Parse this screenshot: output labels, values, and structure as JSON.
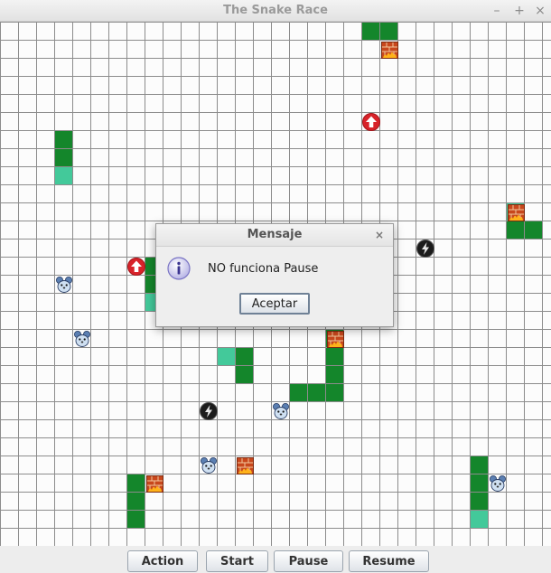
{
  "window": {
    "title": "The Snake Race",
    "minimize_glyph": "–",
    "maximize_glyph": "+",
    "close_glyph": "×"
  },
  "board": {
    "cols": 31,
    "rows": 29,
    "snake_color": "#14862b",
    "tail_color": "#43c99a",
    "snakes": [
      {
        "body": [
          [
            20,
            0
          ],
          [
            21,
            0
          ]
        ],
        "tail": []
      },
      {
        "body": [
          [
            3,
            6
          ],
          [
            3,
            7
          ]
        ],
        "tail": [
          [
            3,
            8
          ]
        ]
      },
      {
        "body": [
          [
            28,
            11
          ],
          [
            29,
            11
          ]
        ],
        "tail": [
          [
            28,
            10
          ]
        ]
      },
      {
        "body": [
          [
            8,
            13
          ],
          [
            8,
            14
          ]
        ],
        "tail": [
          [
            8,
            15
          ]
        ]
      },
      {
        "body": [
          [
            13,
            18
          ],
          [
            13,
            19
          ]
        ],
        "tail": [
          [
            12,
            18
          ]
        ]
      },
      {
        "body": [
          [
            16,
            20
          ],
          [
            17,
            20
          ],
          [
            18,
            20
          ],
          [
            18,
            19
          ],
          [
            18,
            18
          ],
          [
            18,
            17
          ]
        ],
        "tail": []
      },
      {
        "body": [
          [
            7,
            25
          ],
          [
            7,
            26
          ],
          [
            7,
            27
          ]
        ],
        "tail": []
      },
      {
        "body": [
          [
            26,
            24
          ],
          [
            26,
            25
          ],
          [
            26,
            26
          ]
        ],
        "tail": [
          [
            26,
            27
          ]
        ]
      }
    ],
    "items": [
      {
        "type": "fire-brick",
        "cell": [
          21,
          1
        ]
      },
      {
        "type": "up-arrow",
        "cell": [
          20,
          5
        ]
      },
      {
        "type": "fire-brick",
        "cell": [
          28,
          10
        ]
      },
      {
        "type": "lightning",
        "cell": [
          23,
          12
        ]
      },
      {
        "type": "up-arrow",
        "cell": [
          7,
          13
        ]
      },
      {
        "type": "mouse",
        "cell": [
          3,
          14
        ]
      },
      {
        "type": "mouse",
        "cell": [
          4,
          17
        ]
      },
      {
        "type": "fire-brick",
        "cell": [
          18,
          17
        ]
      },
      {
        "type": "lightning",
        "cell": [
          11,
          21
        ]
      },
      {
        "type": "mouse",
        "cell": [
          15,
          21
        ]
      },
      {
        "type": "mouse",
        "cell": [
          11,
          24
        ]
      },
      {
        "type": "fire-brick",
        "cell": [
          13,
          24
        ]
      },
      {
        "type": "fire-brick",
        "cell": [
          8,
          25
        ]
      },
      {
        "type": "mouse",
        "cell": [
          27,
          25
        ]
      }
    ]
  },
  "controls": {
    "action_label": "Action",
    "start_label": "Start",
    "pause_label": "Pause",
    "resume_label": "Resume"
  },
  "dialog": {
    "title": "Mensaje",
    "close_glyph": "×",
    "icon": "info-icon",
    "message": "NO funciona Pause",
    "ok_label": "Aceptar"
  }
}
